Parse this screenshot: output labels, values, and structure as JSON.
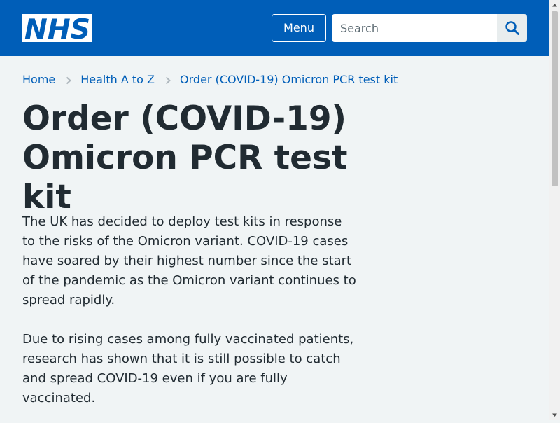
{
  "header": {
    "logo_text": "NHS",
    "menu_label": "Menu",
    "search_placeholder": "Search",
    "search_icon": "search-icon",
    "colors": {
      "background": "#005eb8",
      "text": "#ffffff"
    }
  },
  "breadcrumb": {
    "items": [
      {
        "label": "Home"
      },
      {
        "label": "Health A to Z"
      },
      {
        "label": "Order (COVID-19) Omicron PCR test kit"
      }
    ],
    "separator_icon": "chevron-right-icon"
  },
  "main": {
    "title": "Order (COVID-19) Omicron PCR test kit",
    "paragraphs": [
      "The UK has decided to deploy test kits in response to the risks of the Omicron variant. COVID-19 cases have soared by their highest number since the start of the pandemic as the Omicron variant continues to spread rapidly.",
      "Due to rising cases among fully vaccinated patients, research has shown that it is still possible to catch and spread COVID-19 even if you are fully vaccinated."
    ]
  },
  "colors": {
    "page_background": "#f0f4f5",
    "link": "#005eb8",
    "text": "#212b32"
  }
}
